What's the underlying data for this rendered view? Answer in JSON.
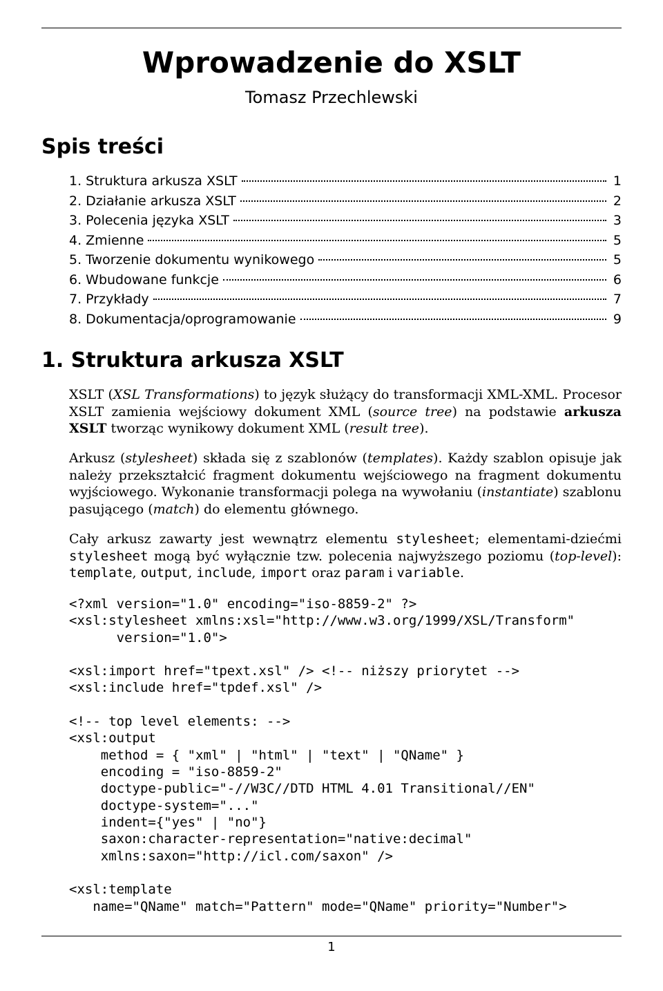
{
  "title": "Wprowadzenie do XSLT",
  "author": "Tomasz Przechlewski",
  "toc_heading": "Spis treści",
  "toc": [
    {
      "label": "1. Struktura arkusza XSLT",
      "page": "1"
    },
    {
      "label": "2. Działanie arkusza XSLT",
      "page": "2"
    },
    {
      "label": "3. Polecenia języka XSLT",
      "page": "3"
    },
    {
      "label": "4. Zmienne",
      "page": "5"
    },
    {
      "label": "5. Tworzenie dokumentu wynikowego",
      "page": "5"
    },
    {
      "label": "6. Wbudowane funkcje",
      "page": "6"
    },
    {
      "label": "7. Przykłady",
      "page": "7"
    },
    {
      "label": "8. Dokumentacja/oprogramowanie",
      "page": "9"
    }
  ],
  "section1": {
    "heading": "1. Struktura arkusza XSLT",
    "para1": {
      "t1": "XSLT (",
      "i1": "XSL Transformations",
      "t2": ") to język służący do transformacji XML-XML. Procesor XSLT zamienia wejściowy dokument XML (",
      "i2": "source tree",
      "t3": ") na podstawie ",
      "b1": "arkusza XSLT",
      "t4": " tworząc wynikowy dokument XML (",
      "i3": "result tree",
      "t5": ")."
    },
    "para2": {
      "t1": "Arkusz (",
      "i1": "stylesheet",
      "t2": ") składa się z szablonów (",
      "i2": "templates",
      "t3": "). Każdy szablon opisuje jak należy przekształcić fragment dokumentu wejściowego na fragment dokumentu wyjściowego. Wykonanie transformacji polega na wywołaniu (",
      "i3": "instantiate",
      "t4": ") szablonu pasującego (",
      "i4": "match",
      "t5": ") do elementu głównego."
    },
    "para3": {
      "t1": "Cały arkusz zawarty jest wewnątrz elementu ",
      "m1": "stylesheet",
      "t2": "; elementami-dziećmi ",
      "m2": "stylesheet",
      "t3": " mogą być wyłącznie tzw. polecenia najwyższego poziomu (",
      "i1": "top-level",
      "t4": "): ",
      "m3": "template",
      "t5": ", ",
      "m4": "output",
      "t6": ", ",
      "m5": "include",
      "t7": ", ",
      "m6": "import",
      "t8": " oraz ",
      "m7": "param",
      "t9": " i ",
      "m8": "variable",
      "t10": "."
    }
  },
  "code": "<?xml version=\"1.0\" encoding=\"iso-8859-2\" ?>\n<xsl:stylesheet xmlns:xsl=\"http://www.w3.org/1999/XSL/Transform\"\n      version=\"1.0\">\n\n<xsl:import href=\"tpext.xsl\" /> <!-- niższy priorytet -->\n<xsl:include href=\"tpdef.xsl\" />\n\n<!-- top level elements: -->\n<xsl:output\n    method = { \"xml\" | \"html\" | \"text\" | \"QName\" }\n    encoding = \"iso-8859-2\"\n    doctype-public=\"-//W3C//DTD HTML 4.01 Transitional//EN\"\n    doctype-system=\"...\"\n    indent={\"yes\" | \"no\"}\n    saxon:character-representation=\"native:decimal\"\n    xmlns:saxon=\"http://icl.com/saxon\" />\n\n<xsl:template\n   name=\"QName\" match=\"Pattern\" mode=\"QName\" priority=\"Number\">",
  "page_number": "1"
}
